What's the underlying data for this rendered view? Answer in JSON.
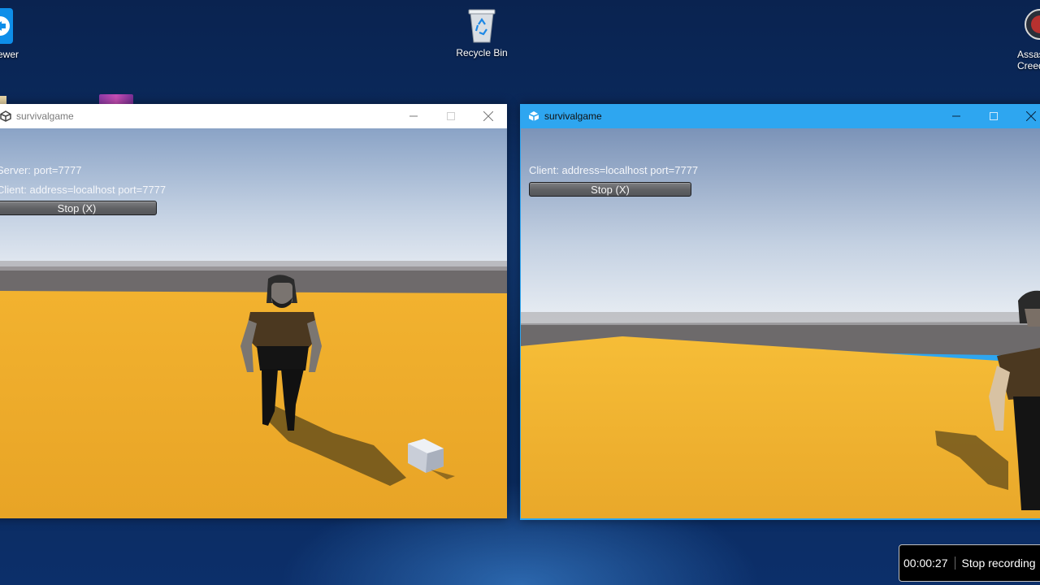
{
  "desktop": {
    "icons": [
      {
        "label": "ewer",
        "icon": "teamviewer-icon"
      },
      {
        "label": "Recycle Bin",
        "icon": "recycle-bin-icon"
      },
      {
        "label": "Assassi",
        "label2": "Creed U",
        "icon": "game-shortcut-icon"
      }
    ]
  },
  "server_window": {
    "title": "survivalgame",
    "state": "inactive",
    "server_text": "Server: port=7777",
    "client_text": "Client: address=localhost port=7777",
    "stop_label": "Stop (X)"
  },
  "client_window": {
    "title": "survivalgame",
    "state": "active",
    "client_text": "Client: address=localhost port=7777",
    "stop_label": "Stop (X)"
  },
  "recording": {
    "timer": "00:00:27",
    "stop_label": "Stop recording"
  },
  "colors": {
    "active_titlebar": "#2ea6f0",
    "inactive_titlebar": "#ffffff",
    "ground": "#eeac2a"
  }
}
